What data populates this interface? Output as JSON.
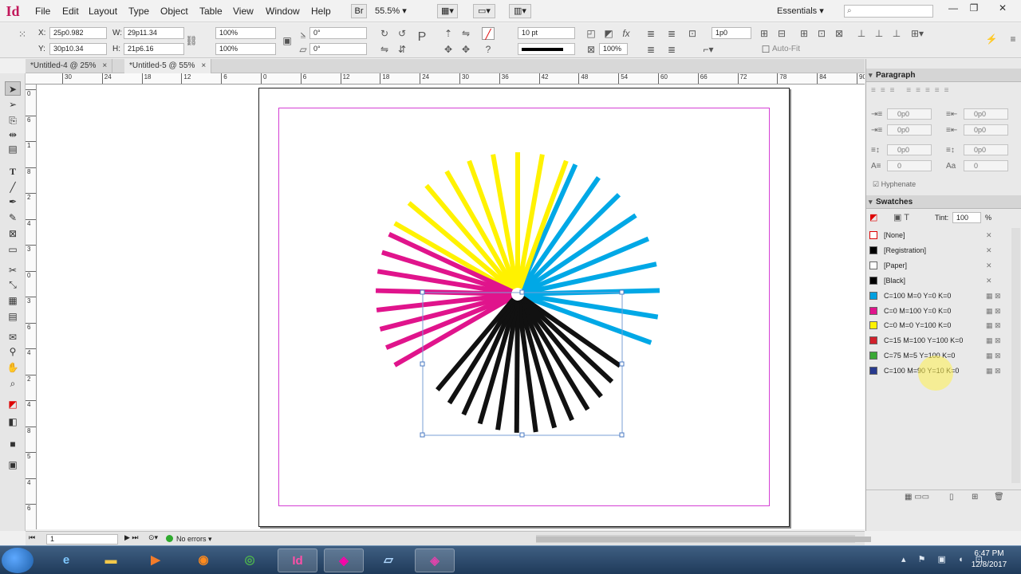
{
  "app": {
    "logo": "Id"
  },
  "menu": {
    "items": [
      "File",
      "Edit",
      "Layout",
      "Type",
      "Object",
      "Table",
      "View",
      "Window",
      "Help"
    ],
    "bridge_label": "Br",
    "zoom": "55.5%",
    "workspace": "Essentials"
  },
  "control": {
    "x_label": "X:",
    "x_value": "25p0.982",
    "y_label": "Y:",
    "y_value": "30p10.34",
    "w_label": "W:",
    "w_value": "29p11.34",
    "h_label": "H:",
    "h_value": "21p6.16",
    "scale_x": "100%",
    "scale_y": "100%",
    "rotate": "0°",
    "shear": "0°",
    "stroke_weight": "10 pt",
    "frame_scale": "100%",
    "offset": "1p0",
    "autofit_label": "Auto-Fit"
  },
  "tabs": [
    {
      "label": "*Untitled-4 @ 25%",
      "close": "×"
    },
    {
      "label": "*Untitled-5 @ 55%",
      "close": "×"
    }
  ],
  "ruler": {
    "h_ticks": [
      "30",
      "24",
      "18",
      "12",
      "6",
      "0",
      "6",
      "12",
      "18",
      "24",
      "30",
      "36",
      "42",
      "48",
      "54",
      "60",
      "66",
      "72",
      "78",
      "84",
      "90"
    ],
    "v_ticks": [
      "0",
      "6",
      "1",
      "8",
      "2",
      "4",
      "3",
      "0",
      "3",
      "6",
      "4",
      "2",
      "4",
      "8",
      "5",
      "4",
      "6"
    ]
  },
  "status": {
    "page": "1",
    "preflight": "No errors"
  },
  "paragraph": {
    "title": "Paragraph",
    "left_indent": "0p0",
    "right_indent": "0p0",
    "first_line": "0p0",
    "last_line": "0p0",
    "space_before": "0p0",
    "space_after": "0p0",
    "drop_lines": "0",
    "drop_chars": "0",
    "hyphenate": "Hyphenate"
  },
  "swatches": {
    "title": "Swatches",
    "tint_label": "Tint:",
    "tint_value": "100",
    "tint_unit": "%",
    "items": [
      {
        "name": "[None]",
        "color": "#ffffff"
      },
      {
        "name": "[Registration]",
        "color": "#000000"
      },
      {
        "name": "[Paper]",
        "color": "#ffffff"
      },
      {
        "name": "[Black]",
        "color": "#000000"
      },
      {
        "name": "C=100 M=0 Y=0 K=0",
        "color": "#00a0e0"
      },
      {
        "name": "C=0 M=100 Y=0 K=0",
        "color": "#e0148c"
      },
      {
        "name": "C=0 M=0 Y=100 K=0",
        "color": "#fff200"
      },
      {
        "name": "C=15 M=100 Y=100 K=0",
        "color": "#d1202b"
      },
      {
        "name": "C=75 M=5 Y=100 K=0",
        "color": "#3aa935"
      },
      {
        "name": "C=100 M=90 Y=10 K=0",
        "color": "#283a8e"
      }
    ]
  },
  "artwork": {
    "segments": [
      {
        "color": "#00a8e6",
        "angle_from": -66,
        "angle_to": 20,
        "count": 9
      },
      {
        "color": "#fff200",
        "angle_from": -150,
        "angle_to": -70,
        "count": 9
      },
      {
        "color": "#e0148c",
        "angle_from": -210,
        "angle_to": -155,
        "count": 8
      },
      {
        "color": "#111111",
        "angle_from": 35,
        "angle_to": 130,
        "count": 13
      }
    ]
  },
  "taskbar": {
    "clock_time": "6:47 PM",
    "clock_date": "12/8/2017",
    "indesign_label": "Id"
  }
}
